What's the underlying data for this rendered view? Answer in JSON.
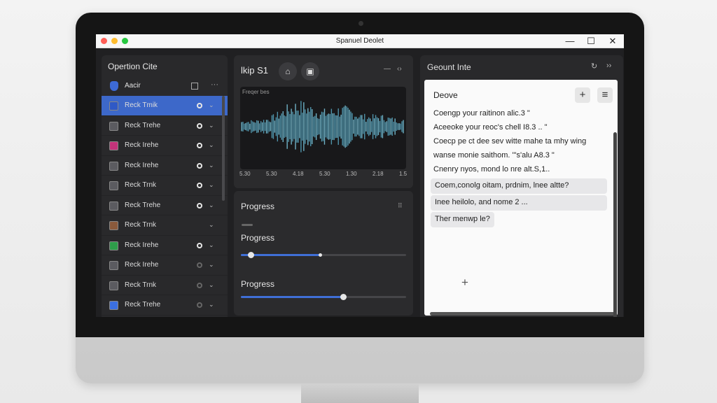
{
  "window": {
    "title": "Spanuel Deolet",
    "controls": {
      "minimize": "—",
      "maximize": "☐",
      "close": "✕"
    }
  },
  "left_panel": {
    "title": "Opertion Cite",
    "asset_row": {
      "label": "Aacir",
      "more": "···"
    },
    "tracks": [
      {
        "label": "Reck Tmik",
        "icon_color": "#2f59c6",
        "selected": true,
        "radio": "on"
      },
      {
        "label": "Reck Trehe",
        "icon_color": "#5b5b60",
        "selected": false,
        "radio": "on"
      },
      {
        "label": "Reck Irehe",
        "icon_color": "#c2337a",
        "selected": false,
        "radio": "on"
      },
      {
        "label": "Reck Irehe",
        "icon_color": "#5b5b60",
        "selected": false,
        "radio": "on"
      },
      {
        "label": "Reck Trnk",
        "icon_color": "#5b5b60",
        "selected": false,
        "radio": "on"
      },
      {
        "label": "Reck Trehe",
        "icon_color": "#5b5b60",
        "selected": false,
        "radio": "on"
      },
      {
        "label": "Reck Trnk",
        "icon_color": "#8a5a3c",
        "selected": false,
        "radio": "none"
      },
      {
        "label": "Reck Irehe",
        "icon_color": "#2e9e4a",
        "selected": false,
        "radio": "on"
      },
      {
        "label": "Reck Irehe",
        "icon_color": "#5b5b60",
        "selected": false,
        "radio": "dim"
      },
      {
        "label": "Reck Trnk",
        "icon_color": "#5b5b60",
        "selected": false,
        "radio": "dim"
      },
      {
        "label": "Reck Trehe",
        "icon_color": "#3b6fe0",
        "selected": false,
        "radio": "dim"
      }
    ]
  },
  "audio_panel": {
    "title": "lkip S1",
    "home_icon": "⌂",
    "square_icon": "▣",
    "min_icon": "—",
    "expand_icon": "‹›",
    "waveform_label": "Freqer bes",
    "time_ticks": [
      "5.30",
      "5.30",
      "4.18",
      "5.30",
      "1.30",
      "2.18",
      "1.5"
    ]
  },
  "progress_panel": {
    "heading": "Progress",
    "grid_icon": "⠿",
    "bars": [
      {
        "label": "Progress",
        "fraction": 0.48,
        "knob_fraction": 0.06
      },
      {
        "label": "Progress",
        "fraction": 0.62,
        "knob_fraction": 0.62
      }
    ]
  },
  "right_panel": {
    "title": "Geount Inte",
    "icons": {
      "refresh": "↻",
      "expand": "››"
    },
    "chat": {
      "title": "Deove",
      "add_button": "+",
      "menu_button": "≡",
      "lines": [
        "Coengp your raitinon alic.3 \"",
        "Aceeoke your reoc's chell I8.3 .. \"",
        "Coecp pe ct dee sev witte mahe ta mhy wing",
        "wanse monie saithom. \"'s'alu A8.3 \"",
        "Cnenry nyos, mond lo nre alt.S,1.."
      ],
      "bubbles": [
        "Coem,conolg oitam, prdnim, lnee altte?",
        "Inee heilolo, and nome 2 ...",
        "Ther menwp le?"
      ],
      "add_icon": "+"
    }
  }
}
